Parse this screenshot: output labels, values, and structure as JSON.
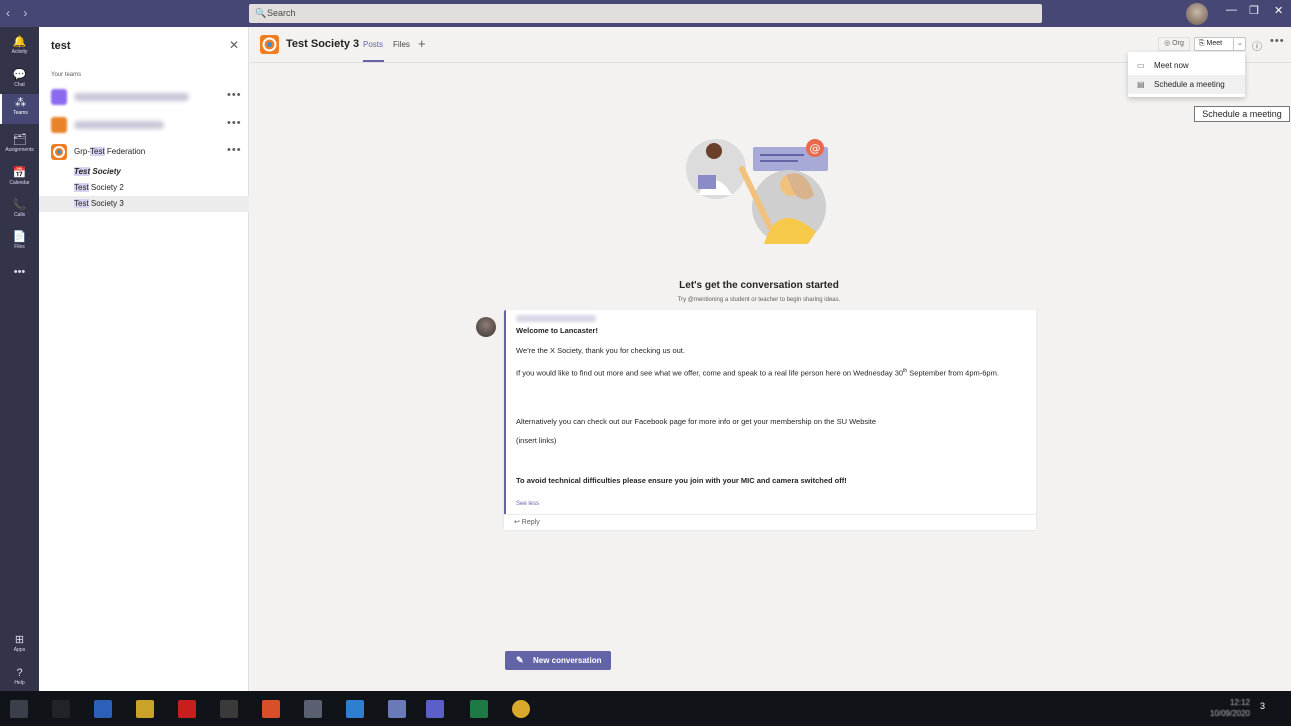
{
  "titlebar": {
    "back": "‹",
    "forward": "›",
    "search_placeholder": "Search",
    "search_icon": "🔍",
    "minimize": "—",
    "maximize": "❐",
    "close": "✕"
  },
  "rail": [
    {
      "icon": "bell-icon",
      "glyph": "🔔",
      "label": "Activity"
    },
    {
      "icon": "chat-icon",
      "glyph": "💬",
      "label": "Chat"
    },
    {
      "icon": "teams-icon",
      "glyph": "⁂",
      "label": "Teams"
    },
    {
      "icon": "assignments-icon",
      "glyph": "🗂",
      "label": "Assignments"
    },
    {
      "icon": "calendar-icon",
      "glyph": "📅",
      "label": "Calendar"
    },
    {
      "icon": "phone-icon",
      "glyph": "📞",
      "label": "Calls"
    },
    {
      "icon": "files-icon",
      "glyph": "📄",
      "label": "Files"
    },
    {
      "icon": "more-icon",
      "glyph": "•••",
      "label": ""
    },
    {
      "icon": "apps-icon",
      "glyph": "⊞",
      "label": "Apps"
    },
    {
      "icon": "help-icon",
      "glyph": "?",
      "label": "Help"
    }
  ],
  "panel": {
    "title": "test",
    "close": "✕",
    "your_teams": "Your teams",
    "more": "•••",
    "team3_prefix": "Grp-",
    "team3_hl": "Test",
    "team3_suffix": " Federation",
    "channels": [
      {
        "hl": "Test",
        "rest": " Society"
      },
      {
        "hl": "Test",
        "rest": " Society 2"
      },
      {
        "hl": "Test",
        "rest": " Society 3"
      }
    ]
  },
  "header": {
    "team_name": "Test Society 3",
    "tab_posts": "Posts",
    "tab_files": "Files",
    "add_tab": "+",
    "org": "◎ Org",
    "meet": "⎘ Meet",
    "meet_caret": "⌄",
    "info": "ⓘ",
    "more": "•••"
  },
  "dropdown": {
    "meet_now": "Meet now",
    "meet_now_icon": "▭",
    "schedule": "Schedule a meeting",
    "schedule_icon": "▤"
  },
  "tooltip": "Schedule a meeting",
  "conversation": {
    "title": "Let's get the conversation started",
    "subtitle": "Try @mentioning a student or teacher to begin sharing ideas."
  },
  "post": {
    "welcome": "Welcome to Lancaster!",
    "line1": "We’re the X Society, thank you for checking us out.",
    "line2a": "If you would like to find out more and see what we offer, come and speak to a real life person here on Wednesday 30",
    "line2sup": "th",
    "line2b": " September from 4pm-6pm.",
    "line3": "Alternatively you can check out our Facebook page for more info or get your membership on the SU Website",
    "line4": "(insert links)",
    "line5": "To avoid technical difficulties please ensure you join with your MIC and camera switched off!",
    "see_less": "See less",
    "reply": "↩ Reply"
  },
  "new_conversation": "New conversation",
  "new_conversation_icon": "✎",
  "taskbar": {
    "clock_time": "12:12",
    "clock_date": "10/09/2020",
    "notifications": "3"
  }
}
